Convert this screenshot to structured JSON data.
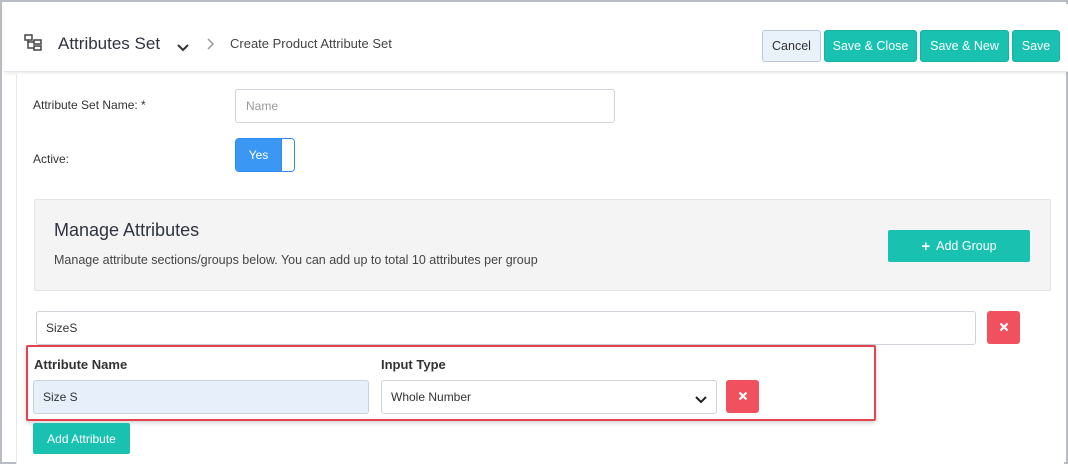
{
  "header": {
    "title": "Attributes Set",
    "breadcrumb": "Create Product Attribute Set",
    "icons": {
      "menu": "hierarchy-icon",
      "title_dropdown": "chevron-down-icon",
      "separator": "chevron-right-icon"
    },
    "buttons": {
      "cancel": "Cancel",
      "save_close": "Save & Close",
      "save_new": "Save & New",
      "save": "Save"
    }
  },
  "form": {
    "name_label": "Attribute Set Name: *",
    "name_placeholder": "Name",
    "active_label": "Active:",
    "active_toggle_label": "Yes"
  },
  "manage": {
    "title": "Manage Attributes",
    "description": "Manage attribute sections/groups below. You can add up to total 10 attributes per group",
    "add_group_label": "Add Group"
  },
  "group": {
    "name_value": "SizeS",
    "attribute_name_header": "Attribute Name",
    "input_type_header": "Input Type",
    "attributes": [
      {
        "name": "Size S",
        "input_type": "Whole Number"
      }
    ],
    "add_attribute_label": "Add Attribute"
  },
  "colors": {
    "accent_teal": "#19c2b0",
    "danger_red": "#f1505f",
    "toggle_blue": "#3a97f3",
    "highlight_red": "#e2454f"
  }
}
